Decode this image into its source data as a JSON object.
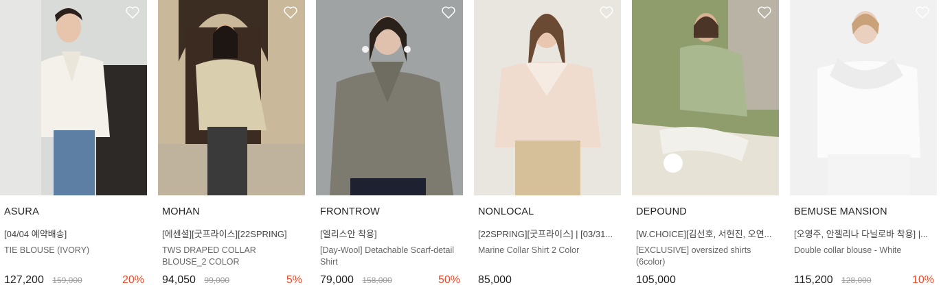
{
  "products": [
    {
      "brand": "ASURA",
      "tag": "[04/04 예약배송]",
      "name": "TIE BLOUSE (IVORY)",
      "price": "127,200",
      "original": "159,000",
      "discount": "20%",
      "colors": {
        "bg": "#d9dbd8",
        "shirt": "#f4f1ea",
        "pants": "#5c7fa3",
        "hair": "#2a1f1a",
        "skin": "#e7c5ad"
      }
    },
    {
      "brand": "MOHAN",
      "tag": "[에센셜][굿프라이스][22SPRING]",
      "name": "TWS DRAPED COLLAR BLOUSE_2 COLOR",
      "price": "94,050",
      "original": "99,000",
      "discount": "5%",
      "colors": {
        "bg": "#c9b899",
        "shirt": "#d9cfae",
        "pants": "#3a3a3a",
        "hair": "#1d1612",
        "skin": "#d8b08f"
      }
    },
    {
      "brand": "FRONTROW",
      "tag": "[엘리스안 착용]",
      "name": "[Day-Wool] Detachable Scarf-detail Shirt",
      "price": "79,000",
      "original": "158,000",
      "discount": "50%",
      "colors": {
        "bg": "#9fa3a3",
        "shirt": "#7d7a70",
        "pants": "#1e2230",
        "hair": "#2b211b",
        "skin": "#e0c1ad"
      }
    },
    {
      "brand": "NONLOCAL",
      "tag": "[22SPRING][굿프라이스] | [03/31...",
      "name": "Marine Collar Shirt 2 Color",
      "price": "85,000",
      "original": "",
      "discount": "",
      "colors": {
        "bg": "#e9e6e0",
        "shirt": "#efdccf",
        "pants": "#d6c09a",
        "hair": "#6b4a33",
        "skin": "#e8c6b0"
      }
    },
    {
      "brand": "DEPOUND",
      "tag": "[W.CHOICE][김선호, 서현진, 오연...",
      "name": "[EXCLUSIVE] oversized shirts (6color)",
      "price": "105,000",
      "original": "",
      "discount": "",
      "colors": {
        "bg": "#8f9d6d",
        "shirt": "#aab88f",
        "pants": "#f2f0ea",
        "hair": "#4a3527",
        "skin": "#d9b294"
      }
    },
    {
      "brand": "BEMUSE MANSION",
      "tag": "[오영주, 안젤리나 다닐로바 착용] |...",
      "name": "Double collar blouse - White",
      "price": "115,200",
      "original": "128,000",
      "discount": "10%",
      "colors": {
        "bg": "#f1f1f1",
        "shirt": "#fbfbfb",
        "pants": "#f4f4f4",
        "hair": "#c9a27a",
        "skin": "#ead0bf"
      }
    }
  ],
  "icons": {
    "wishlist": "heart-outline-icon"
  }
}
